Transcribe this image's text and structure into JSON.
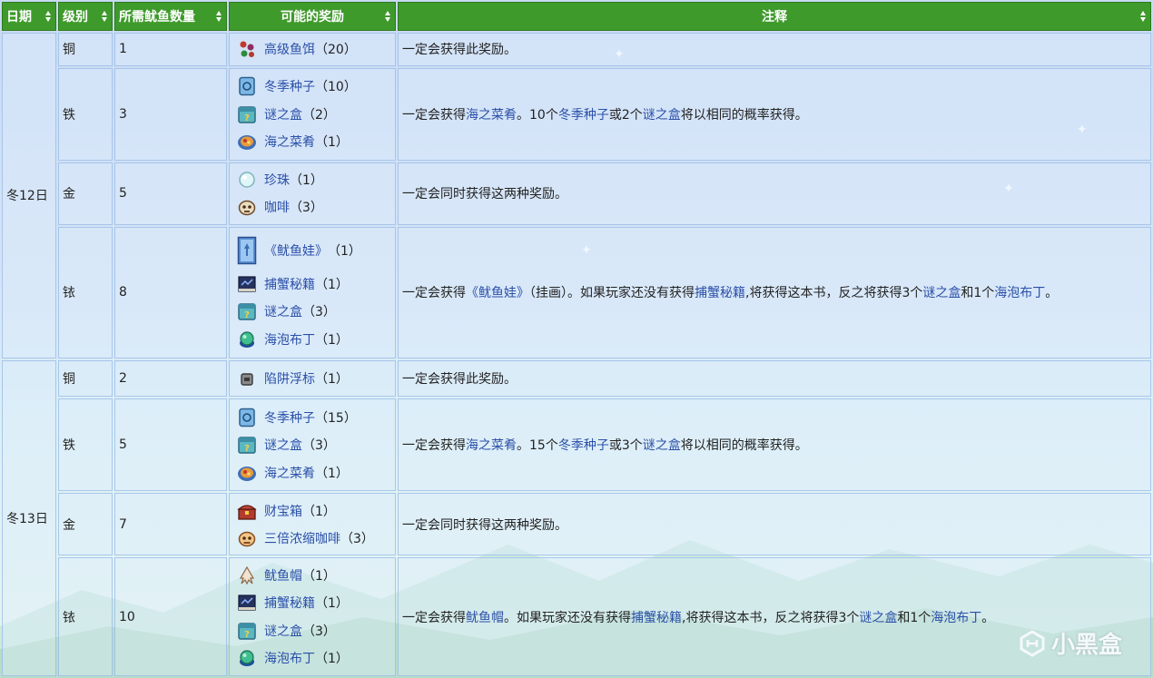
{
  "headers": [
    "日期",
    "级别",
    "所需鱿鱼数量",
    "可能的奖励",
    "注释"
  ],
  "days": [
    {
      "date": "冬12日",
      "rows": [
        {
          "tier": "铜",
          "count": "1",
          "rewards": [
            {
              "icon": "bait-icon",
              "name": "高级鱼饵",
              "qty": "（20）"
            }
          ],
          "note": [
            {
              "t": "一定会获得此奖励。"
            }
          ]
        },
        {
          "tier": "铁",
          "count": "3",
          "rewards": [
            {
              "icon": "winter-seeds-icon",
              "name": "冬季种子",
              "qty": "（10）"
            },
            {
              "icon": "mystery-box-icon",
              "name": "谜之盒",
              "qty": "（2）"
            },
            {
              "icon": "seafoam-dish-icon",
              "name": "海之菜肴",
              "qty": "（1）"
            }
          ],
          "note": [
            {
              "t": "一定会获得"
            },
            {
              "t": "海之菜肴",
              "link": true
            },
            {
              "t": "。10个"
            },
            {
              "t": "冬季种子",
              "link": true
            },
            {
              "t": "或2个"
            },
            {
              "t": "谜之盒",
              "link": true
            },
            {
              "t": "将以相同的概率获得。"
            }
          ]
        },
        {
          "tier": "金",
          "count": "5",
          "rewards": [
            {
              "icon": "pearl-icon",
              "name": "珍珠",
              "qty": "（1）"
            },
            {
              "icon": "coffee-icon",
              "name": "咖啡",
              "qty": "（3）"
            }
          ],
          "note": [
            {
              "t": "一定会同时获得这两种奖励。"
            }
          ]
        },
        {
          "tier": "铱",
          "count": "8",
          "rewards": [
            {
              "icon": "squid-painting-icon",
              "name": "《鱿鱼娃》",
              "qty": "（1）"
            },
            {
              "icon": "book-icon",
              "name": "捕蟹秘籍",
              "qty": "（1）"
            },
            {
              "icon": "mystery-box-icon",
              "name": "谜之盒",
              "qty": "（3）"
            },
            {
              "icon": "pudding-icon",
              "name": "海泡布丁",
              "qty": "（1）"
            }
          ],
          "note": [
            {
              "t": "一定会获得"
            },
            {
              "t": "《鱿鱼娃》",
              "link": true
            },
            {
              "t": "（挂画）。如果玩家还没有获得"
            },
            {
              "t": "捕蟹秘籍",
              "link": true
            },
            {
              "t": ",将获得这本书，反之将获得3个"
            },
            {
              "t": "谜之盒",
              "link": true
            },
            {
              "t": "和1个"
            },
            {
              "t": "海泡布丁",
              "link": true
            },
            {
              "t": "。"
            }
          ]
        }
      ]
    },
    {
      "date": "冬13日",
      "rows": [
        {
          "tier": "铜",
          "count": "2",
          "rewards": [
            {
              "icon": "trap-bobber-icon",
              "name": "陷阱浮标",
              "qty": "（1）"
            }
          ],
          "note": [
            {
              "t": "一定会获得此奖励。"
            }
          ]
        },
        {
          "tier": "铁",
          "count": "5",
          "rewards": [
            {
              "icon": "winter-seeds-icon",
              "name": "冬季种子",
              "qty": "（15）"
            },
            {
              "icon": "mystery-box-icon",
              "name": "谜之盒",
              "qty": "（3）"
            },
            {
              "icon": "seafoam-dish-icon",
              "name": "海之菜肴",
              "qty": "（1）"
            }
          ],
          "note": [
            {
              "t": "一定会获得"
            },
            {
              "t": "海之菜肴",
              "link": true
            },
            {
              "t": "。15个"
            },
            {
              "t": "冬季种子",
              "link": true
            },
            {
              "t": "或3个"
            },
            {
              "t": "谜之盒",
              "link": true
            },
            {
              "t": "将以相同的概率获得。"
            }
          ]
        },
        {
          "tier": "金",
          "count": "7",
          "rewards": [
            {
              "icon": "treasure-chest-icon",
              "name": "财宝箱",
              "qty": "（1）"
            },
            {
              "icon": "triple-espresso-icon",
              "name": "三倍浓缩咖啡",
              "qty": "（3）"
            }
          ],
          "note": [
            {
              "t": "一定会同时获得这两种奖励。"
            }
          ]
        },
        {
          "tier": "铱",
          "count": "10",
          "rewards": [
            {
              "icon": "squid-hat-icon",
              "name": "鱿鱼帽",
              "qty": "（1）"
            },
            {
              "icon": "book-icon",
              "name": "捕蟹秘籍",
              "qty": "（1）"
            },
            {
              "icon": "mystery-box-icon",
              "name": "谜之盒",
              "qty": "（3）"
            },
            {
              "icon": "pudding-icon",
              "name": "海泡布丁",
              "qty": "（1）"
            }
          ],
          "note": [
            {
              "t": "一定会获得"
            },
            {
              "t": "鱿鱼帽",
              "link": true
            },
            {
              "t": "。如果玩家还没有获得"
            },
            {
              "t": "捕蟹秘籍",
              "link": true
            },
            {
              "t": ",将获得这本书，反之将获得3个"
            },
            {
              "t": "谜之盒",
              "link": true
            },
            {
              "t": "和1个"
            },
            {
              "t": "海泡布丁",
              "link": true
            },
            {
              "t": "。"
            }
          ]
        }
      ]
    }
  ],
  "watermark": "小黑盒",
  "colors": {
    "header": "#3f9a2c",
    "link": "#2b50a8"
  }
}
